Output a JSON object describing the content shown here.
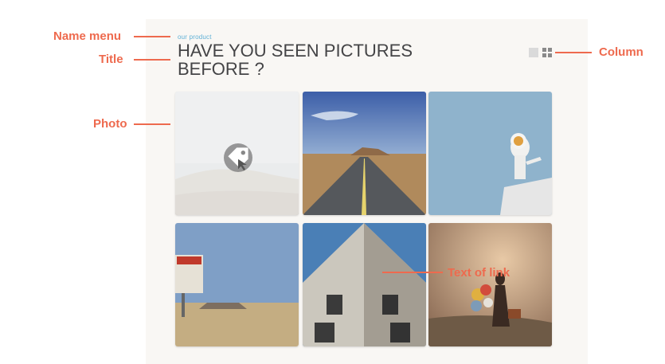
{
  "header": {
    "name_menu": "our product",
    "title": "HAVE YOU SEEN PICTURES BEFORE ?"
  },
  "view_toggle": {
    "icons": [
      "single-column-icon",
      "grid-column-icon"
    ]
  },
  "photos": [
    {
      "name": "photo-desert-hill",
      "subject": "hazy desert hill",
      "overlay_icon": "tag-pointer-icon"
    },
    {
      "name": "photo-desert-road",
      "subject": "desert highway"
    },
    {
      "name": "photo-astronaut",
      "subject": "astronaut toy on blue sky"
    },
    {
      "name": "photo-roadside-sign",
      "subject": "roadside sign in desert"
    },
    {
      "name": "photo-building",
      "subject": "building corner looking up"
    },
    {
      "name": "photo-balloons",
      "subject": "woman with balloons in fog"
    }
  ],
  "annotations": {
    "name_menu": "Name menu",
    "title": "Title",
    "photo": "Photo",
    "column": "Column",
    "text_of_link": "Text of link"
  },
  "colors": {
    "accent": "#5fb0d6",
    "annotation": "#ee6a4e",
    "title_text": "#444446",
    "panel_bg": "#f9f7f4"
  }
}
